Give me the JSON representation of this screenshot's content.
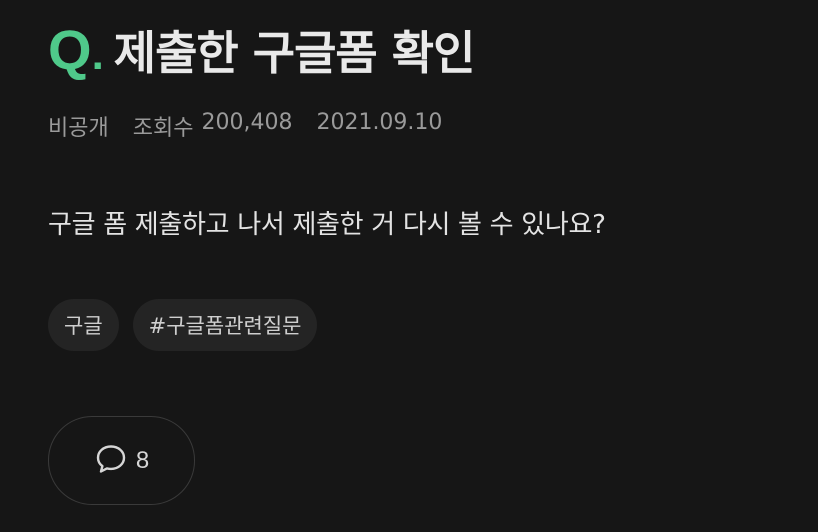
{
  "question": {
    "q_letter": "Q",
    "q_dot": ".",
    "title": "제출한 구글폼 확인",
    "visibility": "비공개",
    "views_label": "조회수",
    "views_count": "200,408",
    "date": "2021.09.10",
    "body": "구글 폼 제출하고 나서 제출한 거 다시 볼 수 있나요?"
  },
  "tags": [
    "구글",
    "#구글폼관련질문"
  ],
  "comments": {
    "icon": "speech-bubble-icon",
    "count": "8"
  },
  "colors": {
    "accent": "#4fc98a",
    "background": "#161616",
    "tag_bg": "#242424"
  }
}
